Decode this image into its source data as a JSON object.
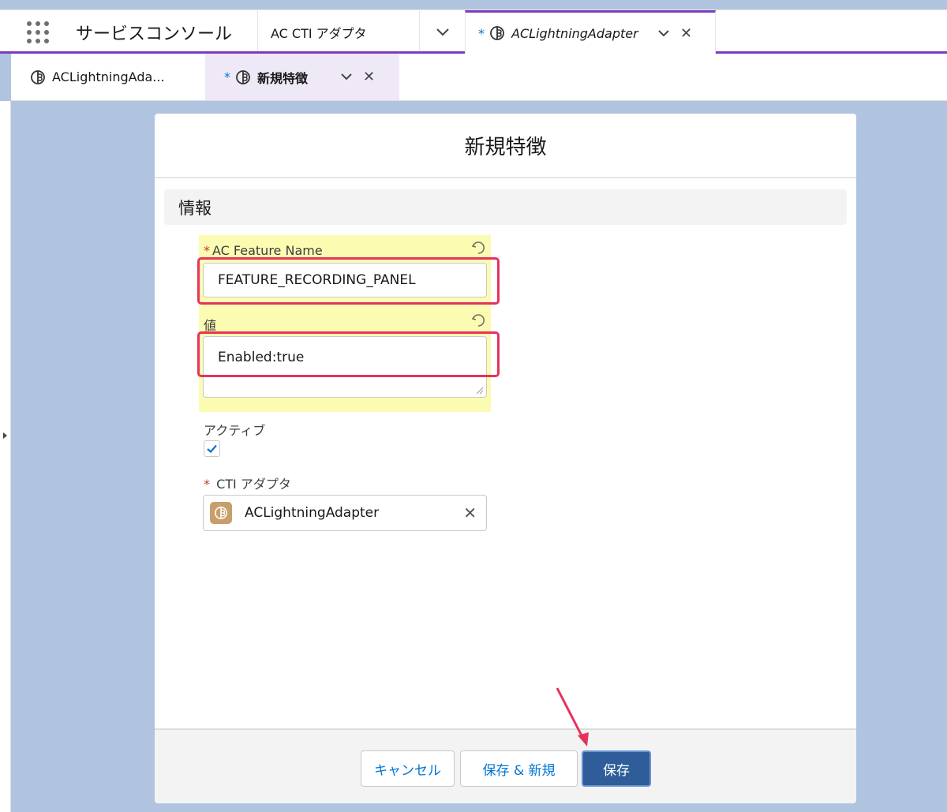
{
  "topnav": {
    "app_name": "サービスコンソール",
    "tabs": [
      {
        "label": "AC CTI アダプタ"
      },
      {
        "label": "ACLightningAdapter",
        "unsaved": "*"
      }
    ]
  },
  "subtabs": [
    {
      "label": "ACLightningAda..."
    },
    {
      "label": "新規特徴",
      "unsaved": "*"
    }
  ],
  "modal": {
    "title": "新規特徴",
    "section_title": "情報",
    "fields": {
      "feature_name": {
        "label": "AC Feature Name",
        "required": "*",
        "value": "FEATURE_RECORDING_PANEL"
      },
      "value": {
        "label": "値",
        "value": "Enabled:true"
      },
      "active": {
        "label": "アクティブ",
        "checked": true
      },
      "cti_adapter": {
        "label": "CTI アダプタ",
        "required": "*",
        "value": "ACLightningAdapter"
      }
    },
    "buttons": {
      "cancel": "キャンセル",
      "save_new": "保存 & 新規",
      "save": "保存"
    }
  },
  "colors": {
    "accent": "#7b3dbf",
    "brand_button": "#2e5d9a",
    "highlight": "#fbfcb2",
    "annotation": "#e6335b"
  }
}
